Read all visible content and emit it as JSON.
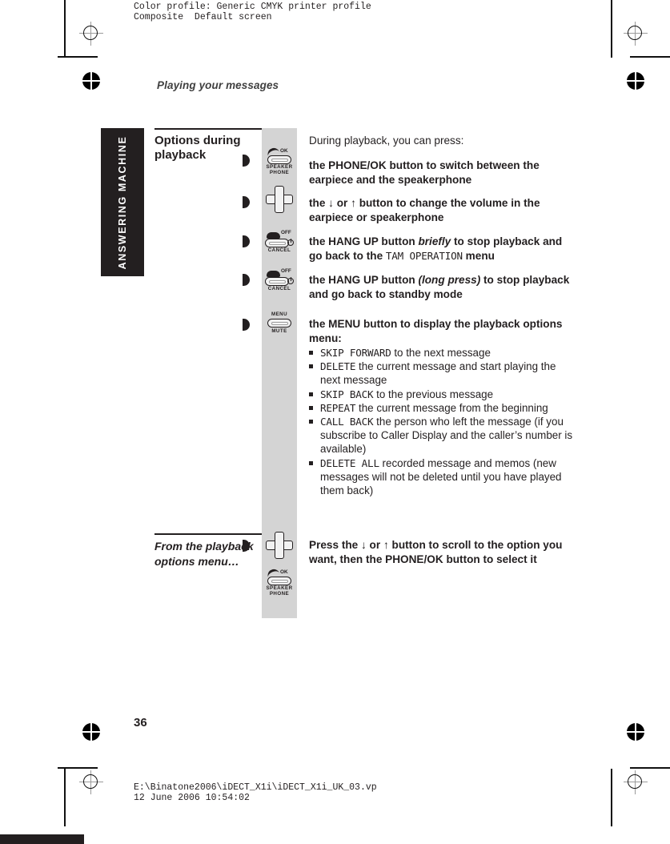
{
  "prepress": {
    "color_profile_line1": "Color profile: Generic CMYK printer profile",
    "color_profile_line2": "Composite  Default screen",
    "footer_path": "E:\\Binatone2006\\iDECT_X1i\\iDECT_X1i_UK_03.vp",
    "footer_timestamp": "12 June 2006 10:54:02"
  },
  "page": {
    "running_head": "Playing your messages",
    "side_tab": "ANSWERING MACHINE",
    "page_number": "36"
  },
  "sections": [
    {
      "heading": "Options during playback",
      "intro": "During playback, you can press:",
      "rows": [
        {
          "icon_name": "phone-ok-speakerphone-key",
          "icon_caption_top": "OK",
          "icon_caption": "SPEAKER PHONE",
          "text_parts": [
            {
              "t": "the ",
              "style": "normal"
            },
            {
              "t": "PHONE/OK",
              "style": "heavy"
            },
            {
              "t": " button to switch between the earpiece and the speakerphone",
              "style": "normal"
            }
          ]
        },
        {
          "icon_name": "navigation-plus-key",
          "icon_caption": "",
          "text_parts": [
            {
              "t": "the ",
              "style": "normal"
            },
            {
              "t": "↓",
              "style": "normal"
            },
            {
              "t": " or ",
              "style": "normal"
            },
            {
              "t": "↑",
              "style": "normal"
            },
            {
              "t": " button to change the volume in the earpiece or speakerphone",
              "style": "normal"
            }
          ]
        },
        {
          "icon_name": "hang-up-off-cancel-key",
          "icon_caption_top": "OFF",
          "icon_caption": "CANCEL",
          "text_parts": [
            {
              "t": "the ",
              "style": "normal"
            },
            {
              "t": "HANG UP",
              "style": "heavy"
            },
            {
              "t": " button ",
              "style": "normal"
            },
            {
              "t": "briefly",
              "style": "italic"
            },
            {
              "t": " to stop playback and go back to the ",
              "style": "normal"
            },
            {
              "t": "TAM OPERATION",
              "style": "lcd"
            },
            {
              "t": " menu",
              "style": "normal"
            }
          ]
        },
        {
          "icon_name": "hang-up-off-cancel-key",
          "icon_caption_top": "OFF",
          "icon_caption": "CANCEL",
          "text_parts": [
            {
              "t": "the ",
              "style": "normal"
            },
            {
              "t": "HANG UP",
              "style": "heavy"
            },
            {
              "t": " button ",
              "style": "normal"
            },
            {
              "t": "(long press)",
              "style": "italic"
            },
            {
              "t": " to stop playback and go back to standby mode",
              "style": "normal"
            }
          ]
        },
        {
          "icon_name": "menu-mute-key",
          "icon_caption_top": "MENU",
          "icon_caption": "MUTE",
          "text_parts": [
            {
              "t": "the ",
              "style": "normal"
            },
            {
              "t": "MENU",
              "style": "heavy"
            },
            {
              "t": " button to display the playback options menu:",
              "style": "normal"
            }
          ]
        }
      ],
      "menu_options": [
        [
          {
            "t": "SKIP FORWARD",
            "style": "lcd"
          },
          {
            "t": " to the next message",
            "style": "normal"
          }
        ],
        [
          {
            "t": "DELETE",
            "style": "lcd"
          },
          {
            "t": " the current message and start playing the next message",
            "style": "normal"
          }
        ],
        [
          {
            "t": "SKIP BACK",
            "style": "lcd"
          },
          {
            "t": " to the previous message",
            "style": "normal"
          }
        ],
        [
          {
            "t": "REPEAT",
            "style": "lcd"
          },
          {
            "t": " the current message from the beginning",
            "style": "normal"
          }
        ],
        [
          {
            "t": "CALL BACK",
            "style": "lcd"
          },
          {
            "t": " the person who left the message (if you subscribe to Caller Display and the caller’s number is available)",
            "style": "normal"
          }
        ],
        [
          {
            "t": "DELETE ALL",
            "style": "lcd"
          },
          {
            "t": " recorded message and memos (new messages will not be deleted until you have played them back)",
            "style": "normal"
          }
        ]
      ]
    },
    {
      "heading": "From the playback options menu…",
      "icons": [
        {
          "icon_name": "navigation-plus-key",
          "caption": ""
        },
        {
          "icon_name": "phone-ok-speakerphone-key",
          "caption": "SPEAKER PHONE"
        }
      ],
      "text_parts": [
        {
          "t": "Press the ",
          "style": "normal"
        },
        {
          "t": "↓",
          "style": "normal"
        },
        {
          "t": " or ",
          "style": "normal"
        },
        {
          "t": "↑",
          "style": "normal"
        },
        {
          "t": " button to scroll to the option you want, then the ",
          "style": "normal"
        },
        {
          "t": "PHONE/OK",
          "style": "heavy"
        },
        {
          "t": " button to select it",
          "style": "normal"
        }
      ]
    }
  ],
  "colors": {
    "ink": "#231f20",
    "gray_column": "#d4d4d4",
    "tab_background": "#231f20"
  }
}
